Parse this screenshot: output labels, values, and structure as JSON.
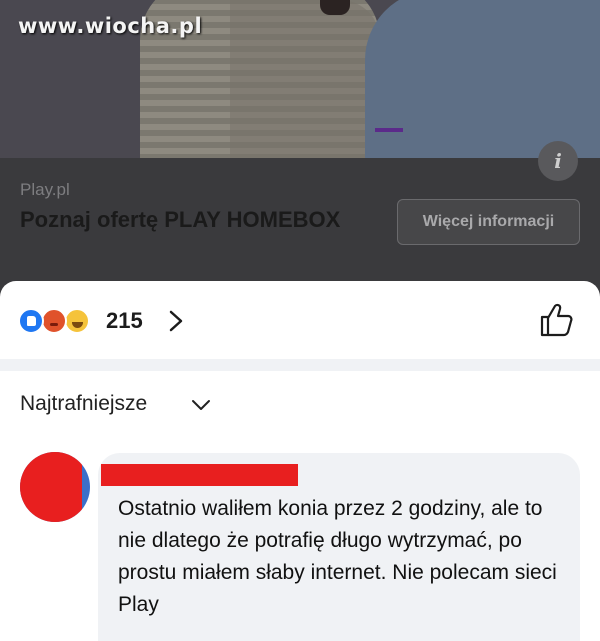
{
  "watermark": "www.wiocha.pl",
  "ad": {
    "source": "Play.pl",
    "title": "Poznaj ofertę PLAY HOMEBOX",
    "more_button": "Więcej informacji",
    "info_icon": "i"
  },
  "reactions": {
    "icons": [
      "like-icon",
      "angry-icon",
      "haha-icon"
    ],
    "count": "215"
  },
  "sort": {
    "label": "Najtrafniejsze"
  },
  "comment": {
    "text": "Ostatnio waliłem konia przez 2 godziny, ale to nie dlatego że potrafię długo wytrzymać, po prostu miałem słaby internet. Nie polecam sieci Play"
  },
  "colors": {
    "redaction": "#e81f1f",
    "like_blue": "#1f77f2",
    "bubble_bg": "#f0f2f5"
  }
}
